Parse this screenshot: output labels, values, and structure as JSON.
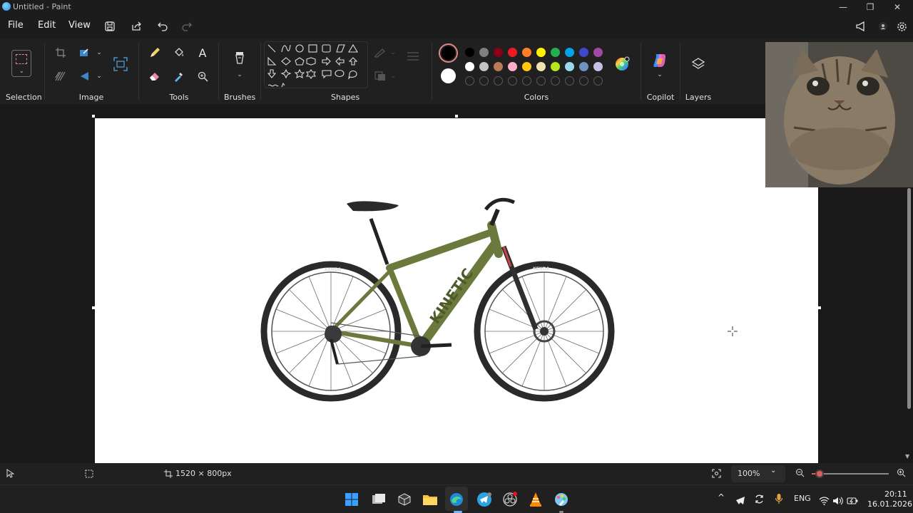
{
  "window": {
    "title": "Untitled - Paint",
    "min": "—",
    "max": "❐",
    "close": "✕"
  },
  "menu": {
    "file": "File",
    "edit": "Edit",
    "view": "View"
  },
  "ribbon": {
    "groups": {
      "selection": "Selection",
      "image": "Image",
      "tools": "Tools",
      "brushes": "Brushes",
      "shapes": "Shapes",
      "colors": "Colors",
      "copilot": "Copilot",
      "layers": "Layers"
    },
    "palette_row1": [
      "#000000",
      "#7f7f7f",
      "#880015",
      "#ed1c24",
      "#ff7f27",
      "#fff200",
      "#22b14c",
      "#00a2e8",
      "#3f48cc",
      "#a349a4"
    ],
    "palette_row2": [
      "#ffffff",
      "#c3c3c3",
      "#b97a57",
      "#ffaec9",
      "#ffc90e",
      "#efe4b0",
      "#b5e61d",
      "#99d9ea",
      "#7092be",
      "#c8bfe7"
    ],
    "primary_color": "#000000",
    "secondary_color": "#ffffff",
    "text_tool_glyph": "A"
  },
  "canvas": {
    "image_brand": "KINETIC",
    "tire_brand_rear": "KENDA",
    "tire_brand_front": "KENDA"
  },
  "status": {
    "canvas_size": "1520 × 800px",
    "zoom": "100%",
    "zoom_level_fraction": 0.1
  },
  "taskbar": {
    "language": "ENG",
    "time": "20:11",
    "date": "16.01.2026"
  }
}
